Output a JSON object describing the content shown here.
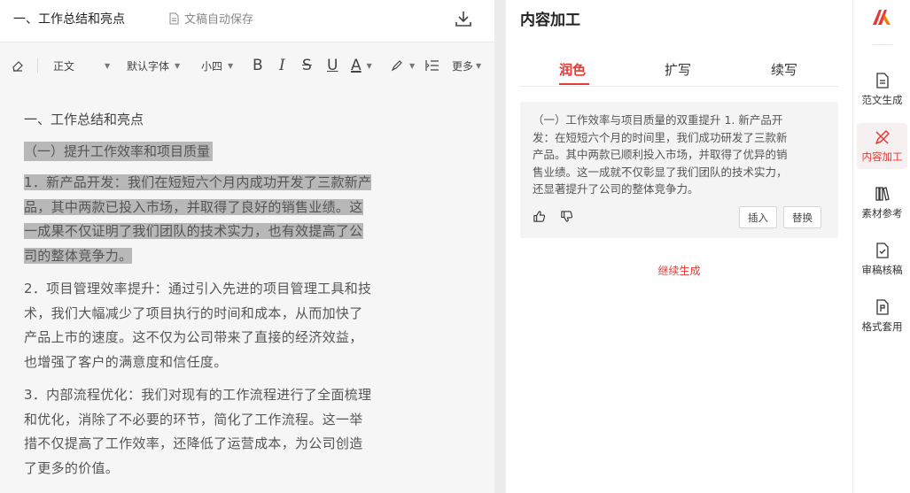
{
  "editor": {
    "doc_title": "一、工作总结和亮点",
    "autosave_label": "文稿自动保存",
    "toolbar": {
      "paragraph_style": "正文",
      "font_family": "默认字体",
      "font_size": "小四",
      "bold": "B",
      "italic": "I",
      "strike": "S",
      "underline": "U",
      "font_color": "A",
      "more": "更多"
    },
    "content": {
      "heading": "一、工作总结和亮点",
      "subheading": "（一）提升工作效率和项目质量",
      "para1_lines": [
        "1．新产品开发：我们在短短六个月内成功开发了三款新产",
        "品，其中两款已投入市场，并取得了良好的销售业绩。这",
        "一成果不仅证明了我们团队的技术实力，也有效提高了公",
        "司的整体竞争力。"
      ],
      "para2_lines": [
        "2．项目管理效率提升：通过引入先进的项目管理工具和技",
        "术，我们大幅减少了项目执行的时间和成本，从而加快了",
        "产品上市的速度。这不仅为公司带来了直接的经济效益，",
        "也增强了客户的满意度和信任度。"
      ],
      "para3_lines": [
        "3．内部流程优化：我们对现有的工作流程进行了全面梳理",
        "和优化，消除了不必要的环节，简化了工作流程。这一举",
        "措不仅提高了工作效率，还降低了运营成本，为公司创造",
        "了更多的价值。"
      ]
    }
  },
  "process_panel": {
    "title": "内容加工",
    "tabs": [
      "润色",
      "扩写",
      "续写"
    ],
    "active_tab": "润色",
    "result_lines": [
      "（一）工作效率与项目质量的双重提升 1. 新产品开",
      "发：在短短六个月的时间里，我们成功研发了三款新",
      "产品。其中两款已顺利投入市场，并取得了优异的销",
      "售业绩。这一成就不仅彰显了我们团队的技术实力，",
      "还显著提升了公司的整体竞争力。"
    ],
    "insert_label": "插入",
    "replace_label": "替换",
    "continue_label": "继续生成"
  },
  "sidebar": {
    "items": [
      {
        "label": "范文生成",
        "icon": "document-icon"
      },
      {
        "label": "内容加工",
        "icon": "edit-pen-icon",
        "active": true
      },
      {
        "label": "素材参考",
        "icon": "books-icon"
      },
      {
        "label": "审稿核稿",
        "icon": "doc-check-icon"
      },
      {
        "label": "格式套用",
        "icon": "format-doc-icon"
      }
    ]
  },
  "colors": {
    "accent": "#e53935",
    "highlight": "#b8b8b8"
  }
}
